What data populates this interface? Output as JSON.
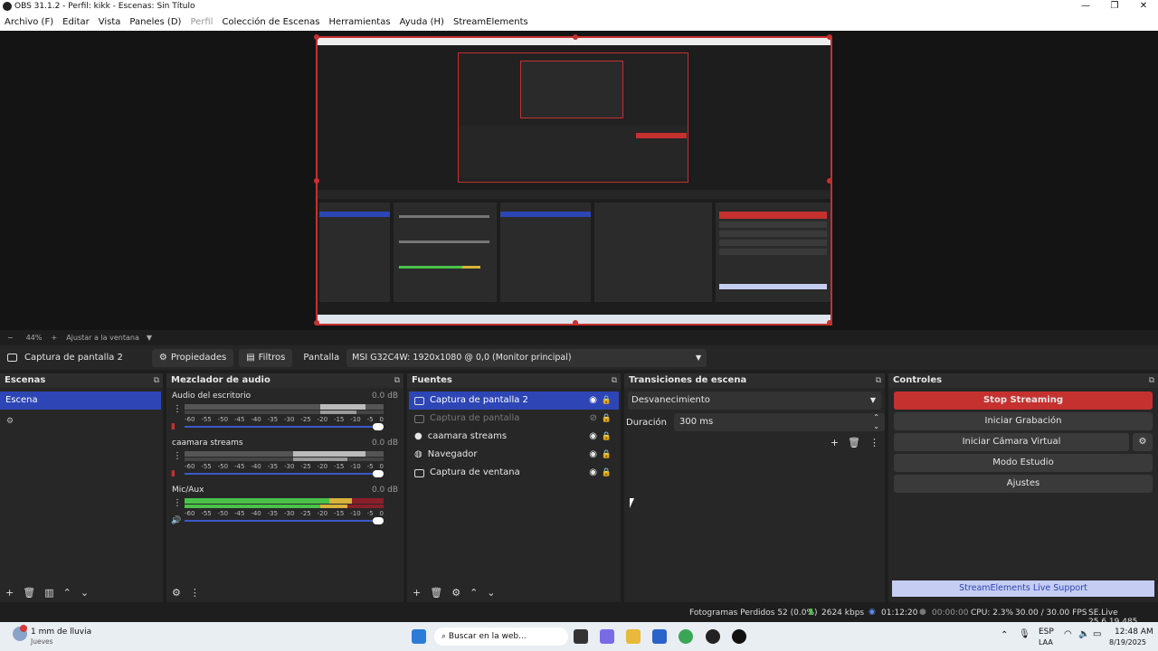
{
  "window": {
    "title": "OBS 31.1.2 - Perfil: kikk - Escenas: Sin Título"
  },
  "menu": [
    "Archivo (F)",
    "Editar",
    "Vista",
    "Paneles (D)",
    "Perfil",
    "Colección de Escenas",
    "Herramientas",
    "Ayuda (H)",
    "StreamElements"
  ],
  "zoom": {
    "minus": "−",
    "value": "44%",
    "plus": "+",
    "fit": "Ajustar a la ventana"
  },
  "sourcebar": {
    "source_name": "Captura de pantalla 2",
    "properties": "Propiedades",
    "filters": "Filtros",
    "display_label": "Pantalla",
    "display_value": "MSI G32C4W: 1920x1080 @ 0,0 (Monitor principal)"
  },
  "scenes": {
    "title": "Escenas",
    "items": [
      "Escena"
    ]
  },
  "mixer": {
    "title": "Mezclador de audio",
    "tracks": [
      {
        "name": "Audio del escritorio",
        "db": "0.0 dB"
      },
      {
        "name": "caamara streams",
        "db": "0.0 dB"
      },
      {
        "name": "Mic/Aux",
        "db": "0.0 dB"
      }
    ],
    "ticks": [
      "-60",
      "-55",
      "-50",
      "-45",
      "-40",
      "-35",
      "-30",
      "-25",
      "-20",
      "-15",
      "-10",
      "-5",
      "0"
    ]
  },
  "sources": {
    "title": "Fuentes",
    "items": [
      "Captura de pantalla 2",
      "Captura de pantalla",
      "caamara streams",
      "Navegador",
      "Captura de ventana"
    ]
  },
  "transitions": {
    "title": "Transiciones de escena",
    "selected": "Desvanecimiento",
    "duration_label": "Duración",
    "duration_value": "300 ms"
  },
  "controls": {
    "title": "Controles",
    "stop_streaming": "Stop Streaming",
    "start_recording": "Iniciar Grabación",
    "virtual_camera": "Iniciar Cámara Virtual",
    "studio_mode": "Modo Estudio",
    "settings": "Ajustes",
    "support": "StreamElements Live Support"
  },
  "status": {
    "dropped": "Fotogramas Perdidos 52 (0.0%)",
    "bitrate": "2624 kbps",
    "stream_time": "01:12:20",
    "rec_time": "00:00:00",
    "cpu": "CPU: 2.3%",
    "fps": "30.00 / 30.00 FPS",
    "version": "SE.Live 25.6.19.485"
  },
  "taskbar": {
    "weather": "1 mm de lluvia",
    "weather_sub": "Jueves",
    "search": "Buscar en la web...",
    "lang": "ESP",
    "lang_sub": "LAA",
    "time": "12:48 AM",
    "date": "8/19/2025"
  },
  "colors": {
    "accent": "#2d45b5",
    "stop": "#c4312f",
    "support": "#c5cdf2"
  }
}
